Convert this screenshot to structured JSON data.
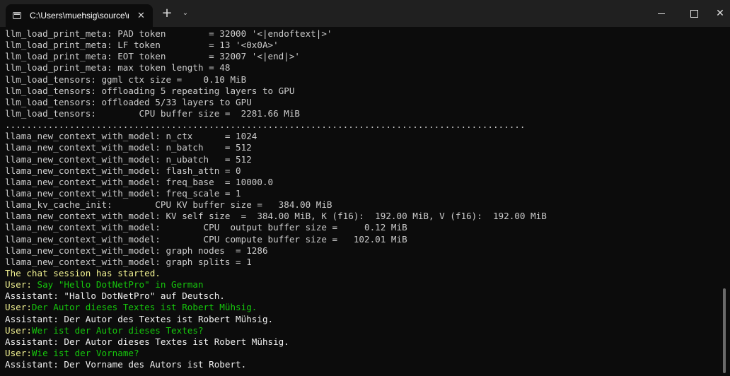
{
  "window": {
    "tab_title": "C:\\Users\\muehsig\\source\\rep",
    "tab_close_glyph": "✕",
    "new_tab_glyph": "+",
    "dropdown_glyph": "⌄",
    "close_glyph": "✕"
  },
  "terminal": {
    "lines": [
      {
        "text": "llm_load_print_meta: PAD token        = 32000 '<|endoftext|>'"
      },
      {
        "text": "llm_load_print_meta: LF token         = 13 '<0x0A>'"
      },
      {
        "text": "llm_load_print_meta: EOT token        = 32007 '<|end|>'"
      },
      {
        "text": "llm_load_print_meta: max token length = 48"
      },
      {
        "text": "llm_load_tensors: ggml ctx size =    0.10 MiB"
      },
      {
        "text": "llm_load_tensors: offloading 5 repeating layers to GPU"
      },
      {
        "text": "llm_load_tensors: offloaded 5/33 layers to GPU"
      },
      {
        "text": "llm_load_tensors:        CPU buffer size =  2281.66 MiB"
      },
      {
        "text": "................................................................................................."
      },
      {
        "text": "llama_new_context_with_model: n_ctx      = 1024"
      },
      {
        "text": "llama_new_context_with_model: n_batch    = 512"
      },
      {
        "text": "llama_new_context_with_model: n_ubatch   = 512"
      },
      {
        "text": "llama_new_context_with_model: flash_attn = 0"
      },
      {
        "text": "llama_new_context_with_model: freq_base  = 10000.0"
      },
      {
        "text": "llama_new_context_with_model: freq_scale = 1"
      },
      {
        "text": "llama_kv_cache_init:        CPU KV buffer size =   384.00 MiB"
      },
      {
        "text": "llama_new_context_with_model: KV self size  =  384.00 MiB, K (f16):  192.00 MiB, V (f16):  192.00 MiB"
      },
      {
        "text": "llama_new_context_with_model:        CPU  output buffer size =     0.12 MiB"
      },
      {
        "text": "llama_new_context_with_model:        CPU compute buffer size =   102.01 MiB"
      },
      {
        "text": "llama_new_context_with_model: graph nodes  = 1286"
      },
      {
        "text": "llama_new_context_with_model: graph splits = 1"
      },
      {
        "text": "The chat session has started."
      },
      {
        "prefix": "User: ",
        "text": "Say \"Hello DotNetPro\" in German"
      },
      {
        "text": "Assistant: \"Hallo DotNetPro\" auf Deutsch."
      },
      {
        "prefix": "User:",
        "text": "Der Autor dieses Textes ist Robert Mühsig."
      },
      {
        "text": "Assistant: Der Autor des Textes ist Robert Mühsig."
      },
      {
        "prefix": "User:",
        "text": "Wer ist der Autor dieses Textes?"
      },
      {
        "text": "Assistant: Der Autor dieses Textes ist Robert Mühsig."
      },
      {
        "prefix": "User:",
        "text": "Wie ist der Vorname?"
      },
      {
        "text": "Assistant: Der Vorname des Autors ist Robert."
      }
    ]
  },
  "colors": {
    "background": "#0c0c0c",
    "log_text": "#cccccc",
    "session_banner": "#f2f292",
    "user_prefix": "#f2f292",
    "user_input": "#16c60c",
    "assistant_text": "#f2f2f2"
  }
}
